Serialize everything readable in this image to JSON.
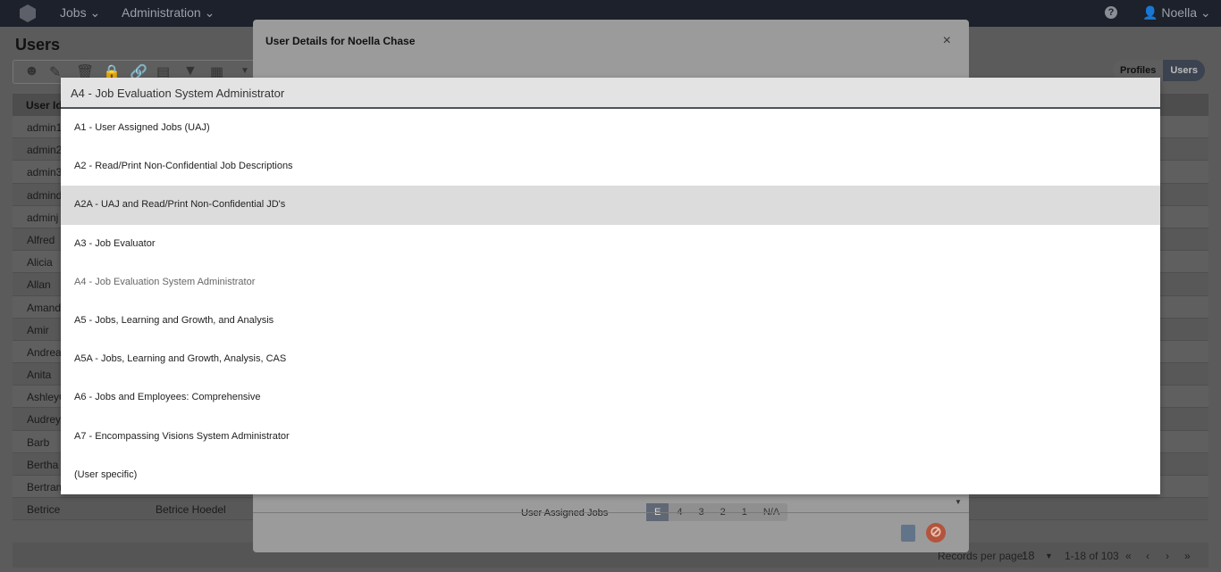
{
  "nav": {
    "menu": [
      {
        "label": "Jobs ⌄"
      },
      {
        "label": "Administration ⌄"
      }
    ],
    "help": "?",
    "user": "Noella ⌄"
  },
  "page": {
    "title": "Users",
    "segments": [
      "Profiles",
      "Users"
    ]
  },
  "table": {
    "header": "User Id",
    "rows": [
      {
        "id": "admin1"
      },
      {
        "id": "admin2"
      },
      {
        "id": "admin3"
      },
      {
        "id": "admind"
      },
      {
        "id": "adminj"
      },
      {
        "id": "Alfred"
      },
      {
        "id": "Alicia"
      },
      {
        "id": "Allan"
      },
      {
        "id": "Amanda"
      },
      {
        "id": "Amir"
      },
      {
        "id": "Andrea"
      },
      {
        "id": "Anita"
      },
      {
        "id": "AshleyC"
      },
      {
        "id": "Audrey"
      },
      {
        "id": "Barb"
      },
      {
        "id": "Bertha"
      },
      {
        "id": "Bertram"
      },
      {
        "id": "Betrice",
        "name": "Betrice Hoedel"
      }
    ]
  },
  "pager": {
    "label": "Records per page:",
    "per_page": "18",
    "range": "1-18 of 103",
    "first": "«",
    "prev": "‹",
    "next": "›",
    "last": "»"
  },
  "modal": {
    "title": "User Details for Noella Chase",
    "close": "×",
    "field_label": "User Assigned Jobs",
    "options": [
      "E",
      "4",
      "3",
      "2",
      "1",
      "N/A"
    ]
  },
  "dropdown": {
    "selected": "A4 - Job Evaluation System Administrator",
    "highlighted": "A2A - UAJ and Read/Print Non-Confidential JD's",
    "options": [
      "A1 - User Assigned Jobs (UAJ)",
      "A2 - Read/Print Non-Confidential Job Descriptions",
      "A2A - UAJ and Read/Print Non-Confidential JD's",
      "A3 - Job Evaluator",
      "A4 - Job Evaluation System Administrator",
      "A5 - Jobs, Learning and Growth, and Analysis",
      "A5A - Jobs, Learning and Growth, Analysis, CAS",
      "A6 - Jobs and Employees: Comprehensive",
      "A7 - Encompassing Visions System Administrator",
      "(User specific)"
    ]
  }
}
